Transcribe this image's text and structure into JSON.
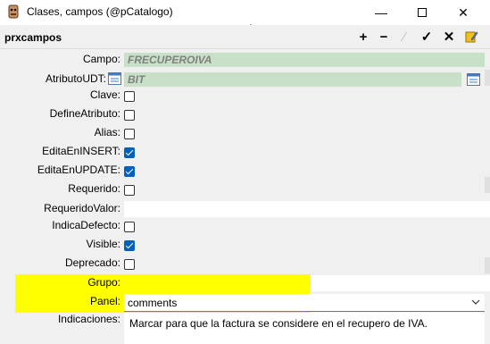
{
  "window": {
    "title": "Clases, campos (@pCatalogo)"
  },
  "toolbar": {
    "title": "prxcampos",
    "add": "+",
    "remove": "−",
    "edit": "⁄",
    "confirm": "✓",
    "cancel": "✕"
  },
  "fields": {
    "campo": {
      "label": "Campo:",
      "value": "FRECUPEROIVA"
    },
    "atributo_udt": {
      "label": "AtributoUDT:",
      "value": "BIT"
    },
    "clave": {
      "label": "Clave:",
      "checked": false
    },
    "define_atributo": {
      "label": "DefineAtributo:",
      "checked": false
    },
    "alias": {
      "label": "Alias:",
      "checked": false
    },
    "edita_insert": {
      "label": "EditaEnINSERT:",
      "checked": true
    },
    "edita_update": {
      "label": "EditaEnUPDATE:",
      "checked": true
    },
    "requerido": {
      "label": "Requerido:",
      "checked": false
    },
    "requerido_valor": {
      "label": "RequeridoValor:",
      "value": ""
    },
    "indica_defecto": {
      "label": "IndicaDefecto:",
      "checked": false
    },
    "visible": {
      "label": "Visible:",
      "checked": true
    },
    "deprecado": {
      "label": "Deprecado:",
      "checked": false
    },
    "grupo": {
      "label": "Grupo:",
      "value": ""
    },
    "panel": {
      "label": "Panel:",
      "value": "comments"
    },
    "indicaciones": {
      "label": "Indicaciones:",
      "value": "Marcar para que la factura se considere en el recupero de IVA."
    }
  },
  "colors": {
    "highlight": "#ffff00",
    "readonly_field": "#c8e0c8",
    "checkbox_checked": "#0060c0"
  }
}
